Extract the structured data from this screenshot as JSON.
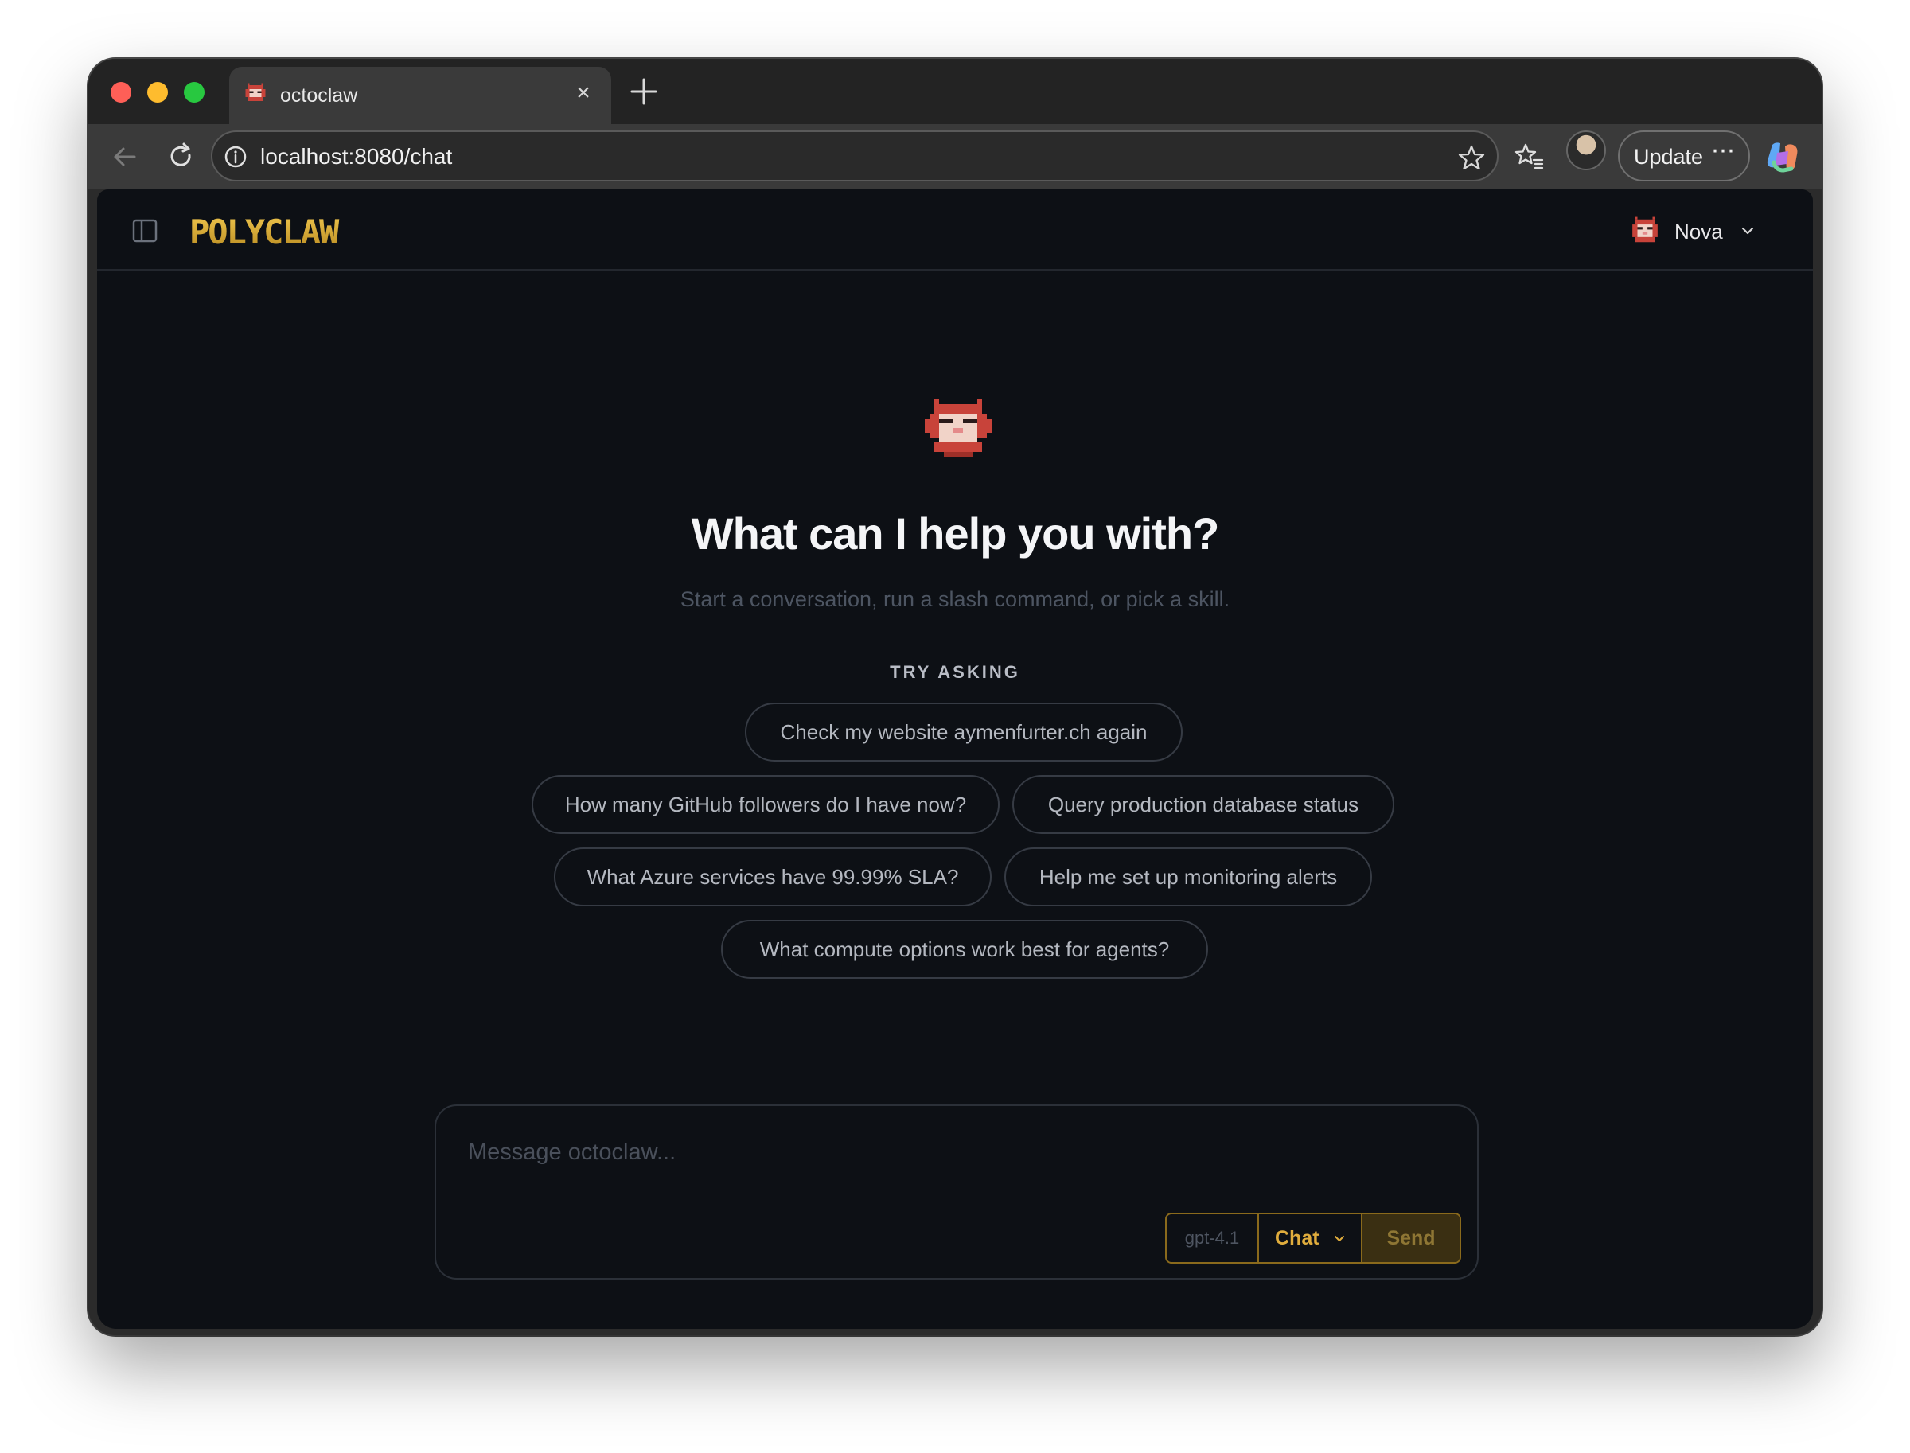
{
  "browser": {
    "tab_title": "octoclaw",
    "url": "localhost:8080/chat",
    "update_label": "Update",
    "update_more": "⋯"
  },
  "header": {
    "logo_text": "POLYCLAW",
    "agent_name": "Nova"
  },
  "hero": {
    "title": "What can I help you with?",
    "subtitle": "Start a conversation, run a slash command, or pick a skill.",
    "try_label": "TRY ASKING"
  },
  "suggestions": [
    "Check my website aymenfurter.ch again",
    "How many GitHub followers do I have now?",
    "Query production database status",
    "What Azure services have 99.99% SLA?",
    "Help me set up monitoring alerts",
    "What compute options work best for agents?"
  ],
  "composer": {
    "placeholder": "Message octoclaw...",
    "model": "gpt-4.1",
    "mode": "Chat",
    "send_label": "Send"
  },
  "colors": {
    "accent": "#e0ad3d",
    "app_background": "#0d1015",
    "avatar_red": "#c8433a"
  }
}
